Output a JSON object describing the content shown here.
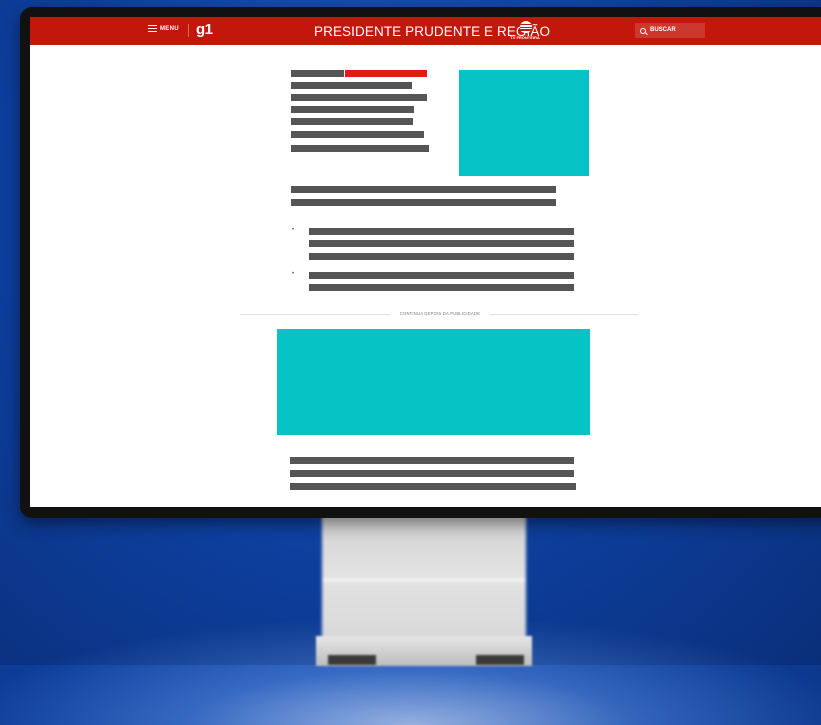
{
  "header": {
    "menu_label": "MENU",
    "logo": "g1",
    "region_title": "PRESIDENTE PRUDENTE E REGIÃO",
    "affiliate": "TV FRONTEIRA",
    "search_label": "BUSCAR"
  },
  "ad_break": {
    "label": "CONTINUA DEPOIS DA PUBLICIDADE"
  },
  "colors": {
    "brand_red": "#c4170c",
    "accent_red": "#e31a17",
    "ad_placeholder": "#06c3c5",
    "text_placeholder": "#555555",
    "background_blue": "#0d3f9e"
  },
  "icons": [
    "hamburger-menu-icon",
    "tv-fronteira-globe-icon",
    "search-icon"
  ],
  "bullets": [
    "•",
    "•"
  ]
}
